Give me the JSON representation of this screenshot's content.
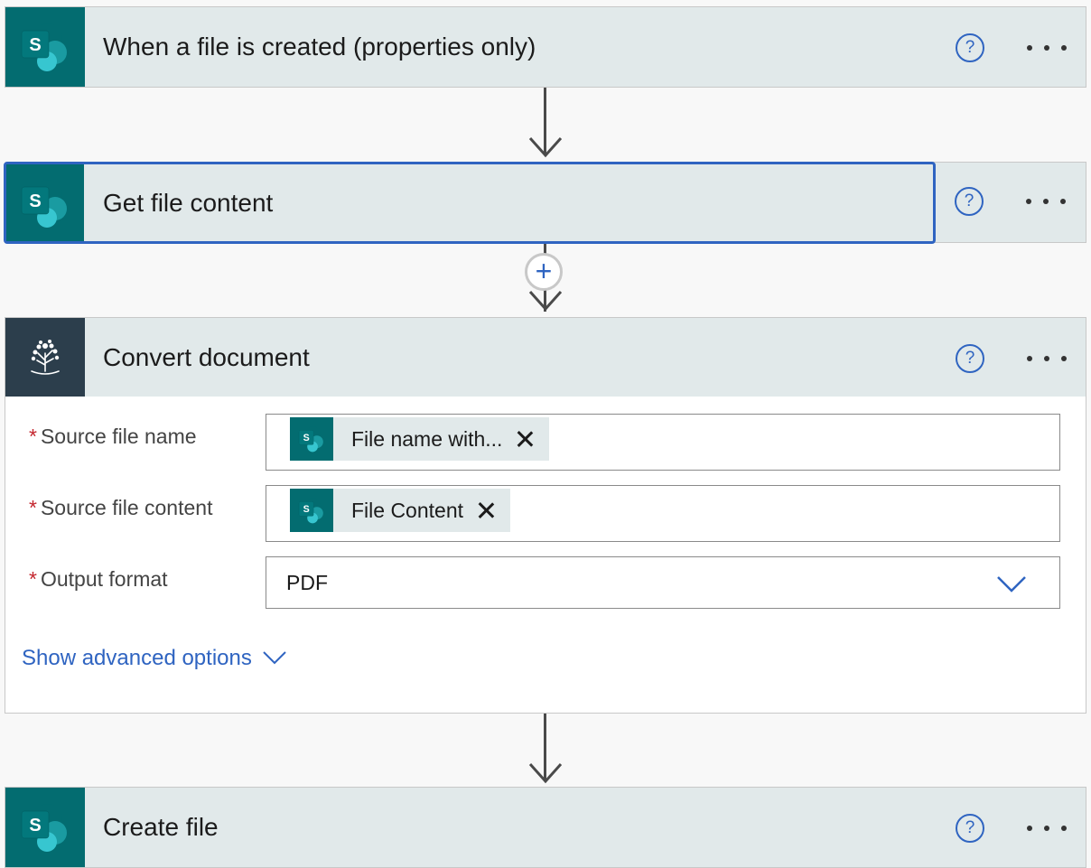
{
  "steps": [
    {
      "title": "When a file is created (properties only)",
      "icon": "sharepoint-icon"
    },
    {
      "title": "Get file content",
      "icon": "sharepoint-icon"
    },
    {
      "title": "Convert document",
      "icon": "convert-tree-icon"
    },
    {
      "title": "Create file",
      "icon": "sharepoint-icon"
    }
  ],
  "help_glyph": "?",
  "add_glyph": "+",
  "convert": {
    "fields": [
      {
        "label": "Source file name",
        "token": "File name with..."
      },
      {
        "label": "Source file content",
        "token": "File Content"
      },
      {
        "label": "Output format",
        "value": "PDF"
      }
    ],
    "required_mark": "*",
    "advanced_label": "Show advanced options"
  },
  "colors": {
    "sharepoint": "#036c70",
    "accent": "#2f64c1",
    "card_header": "#e1e9ea"
  }
}
